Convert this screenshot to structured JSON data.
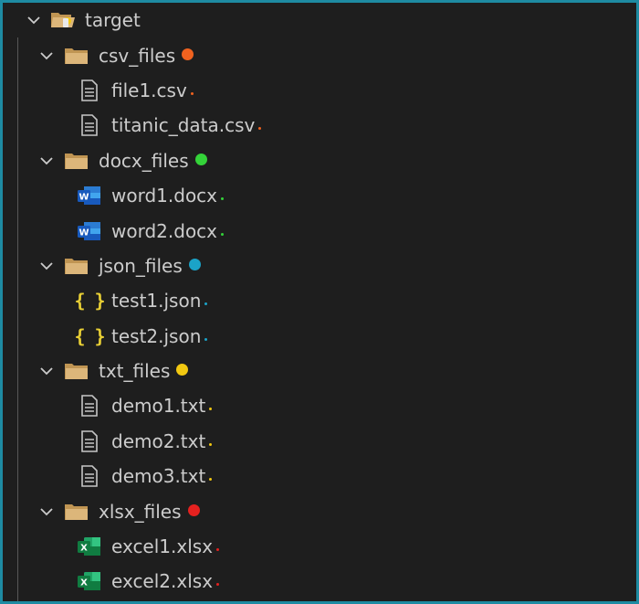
{
  "colors": {
    "background": "#1e1e1e",
    "border": "#1e8ba2",
    "text": "#cccccc",
    "csv": "#f0621f",
    "docx": "#34d339",
    "json": "#1ba3c8",
    "txt": "#f2c811",
    "xlsx": "#e5211f"
  },
  "tree": {
    "root": {
      "label": "target",
      "icon": "folder-open-icon"
    },
    "folders": [
      {
        "label": "csv_files",
        "marker": "csv",
        "files": [
          {
            "label": "file1.csv",
            "icon": "text-file-icon"
          },
          {
            "label": "titanic_data.csv",
            "icon": "text-file-icon"
          }
        ]
      },
      {
        "label": "docx_files",
        "marker": "docx",
        "files": [
          {
            "label": "word1.docx",
            "icon": "word-icon"
          },
          {
            "label": "word2.docx",
            "icon": "word-icon"
          }
        ]
      },
      {
        "label": "json_files",
        "marker": "json",
        "files": [
          {
            "label": "test1.json",
            "icon": "json-icon",
            "glyph": "{ }"
          },
          {
            "label": "test2.json",
            "icon": "json-icon",
            "glyph": "{ }"
          }
        ]
      },
      {
        "label": "txt_files",
        "marker": "txt",
        "files": [
          {
            "label": "demo1.txt",
            "icon": "text-file-icon"
          },
          {
            "label": "demo2.txt",
            "icon": "text-file-icon"
          },
          {
            "label": "demo3.txt",
            "icon": "text-file-icon"
          }
        ]
      },
      {
        "label": "xlsx_files",
        "marker": "xlsx",
        "files": [
          {
            "label": "excel1.xlsx",
            "icon": "excel-icon"
          },
          {
            "label": "excel2.xlsx",
            "icon": "excel-icon"
          }
        ]
      }
    ]
  }
}
